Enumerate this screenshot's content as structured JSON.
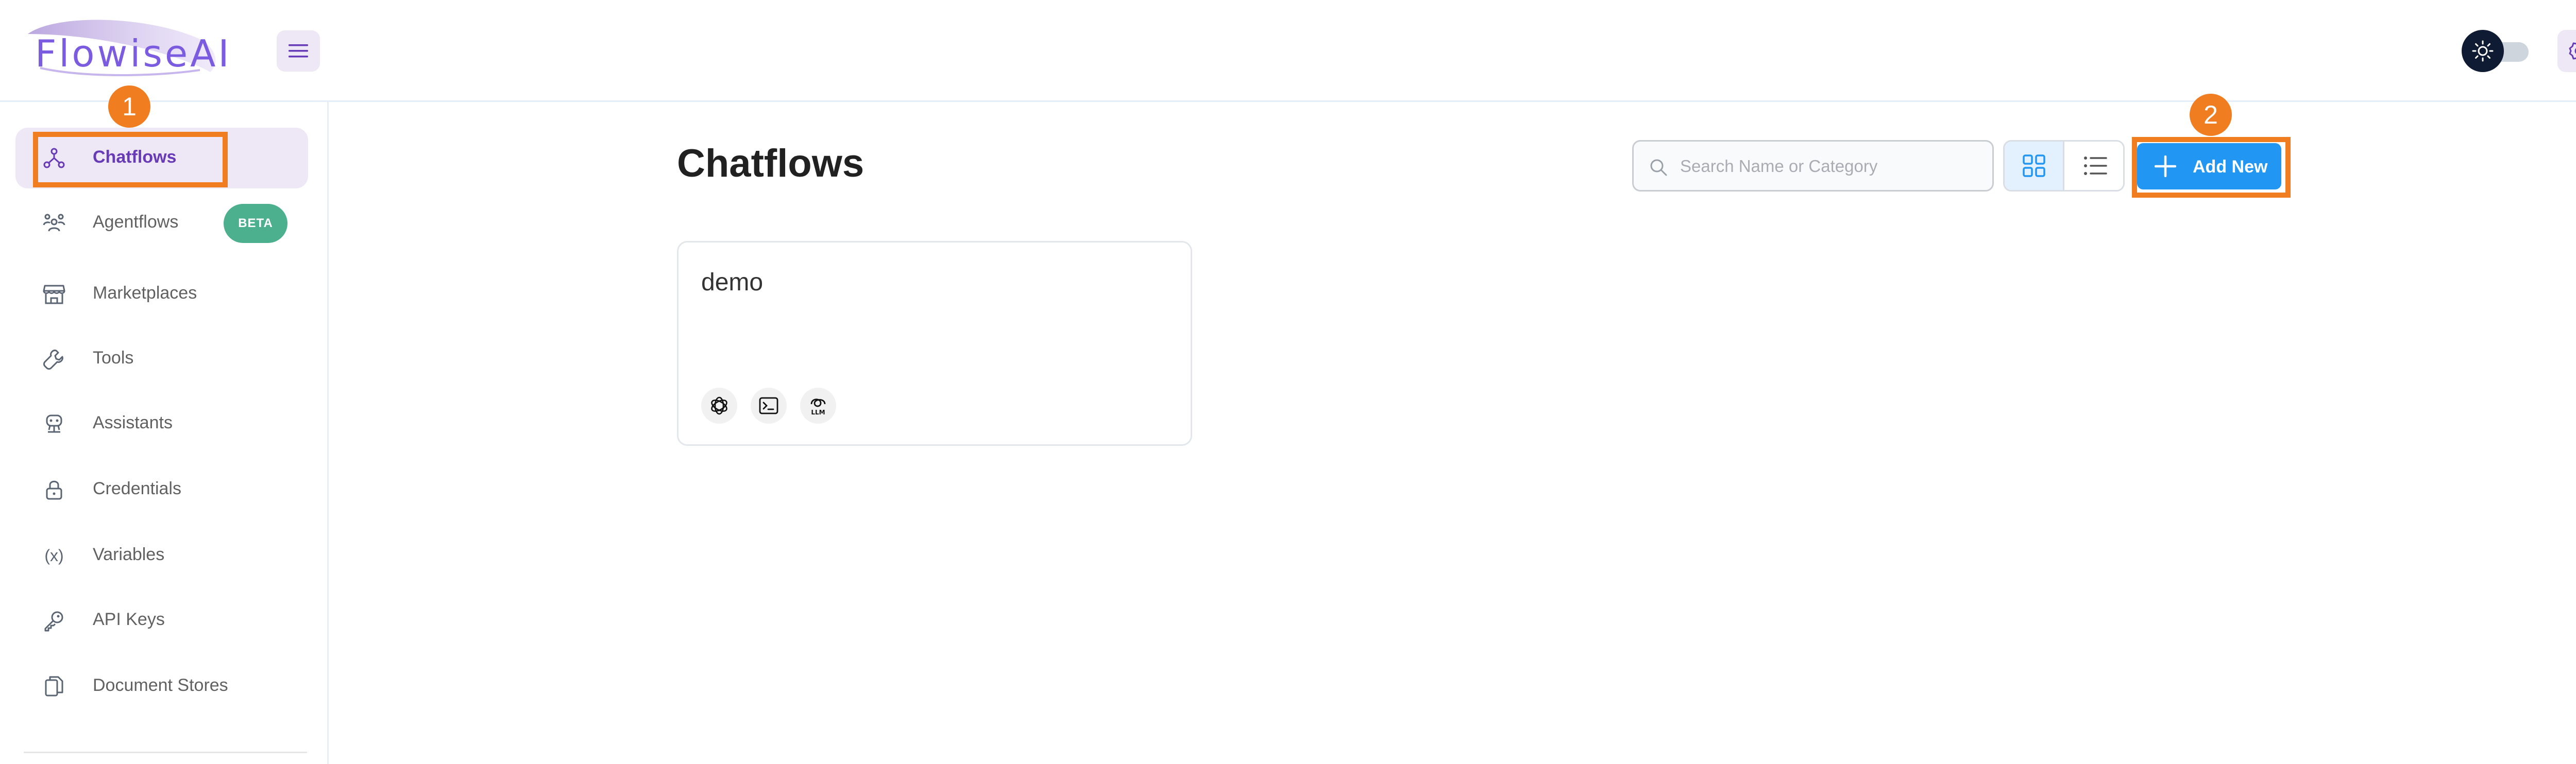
{
  "app": {
    "logo_text": "FlowiseAI",
    "accent_color": "#673ab7",
    "primary_color": "#2196f3",
    "annotation_color": "#f07d1f"
  },
  "header": {
    "menu_icon": "hamburger-icon",
    "theme_icon": "sun-icon",
    "settings_icon": "gear-icon"
  },
  "sidebar": {
    "items": [
      {
        "label": "Chatflows",
        "icon": "chatflow-icon",
        "active": true
      },
      {
        "label": "Agentflows",
        "icon": "agents-icon",
        "badge": "BETA"
      },
      {
        "label": "Marketplaces",
        "icon": "store-icon"
      },
      {
        "label": "Tools",
        "icon": "wrench-icon"
      },
      {
        "label": "Assistants",
        "icon": "robot-icon"
      },
      {
        "label": "Credentials",
        "icon": "lock-icon"
      },
      {
        "label": "Variables",
        "icon": "variable-icon",
        "icon_text": "(x)"
      },
      {
        "label": "API Keys",
        "icon": "key-icon"
      },
      {
        "label": "Document Stores",
        "icon": "documents-icon"
      }
    ]
  },
  "annotations": {
    "marker1": "1",
    "marker2": "2"
  },
  "main": {
    "title": "Chatflows",
    "search_placeholder": "Search Name or Category",
    "search_value": "",
    "view_modes": [
      "grid-view-icon",
      "list-view-icon"
    ],
    "add_button_label": "Add New",
    "cards": [
      {
        "title": "demo",
        "node_icons": [
          "openai-icon",
          "terminal-icon",
          "llm-icon"
        ]
      }
    ]
  }
}
